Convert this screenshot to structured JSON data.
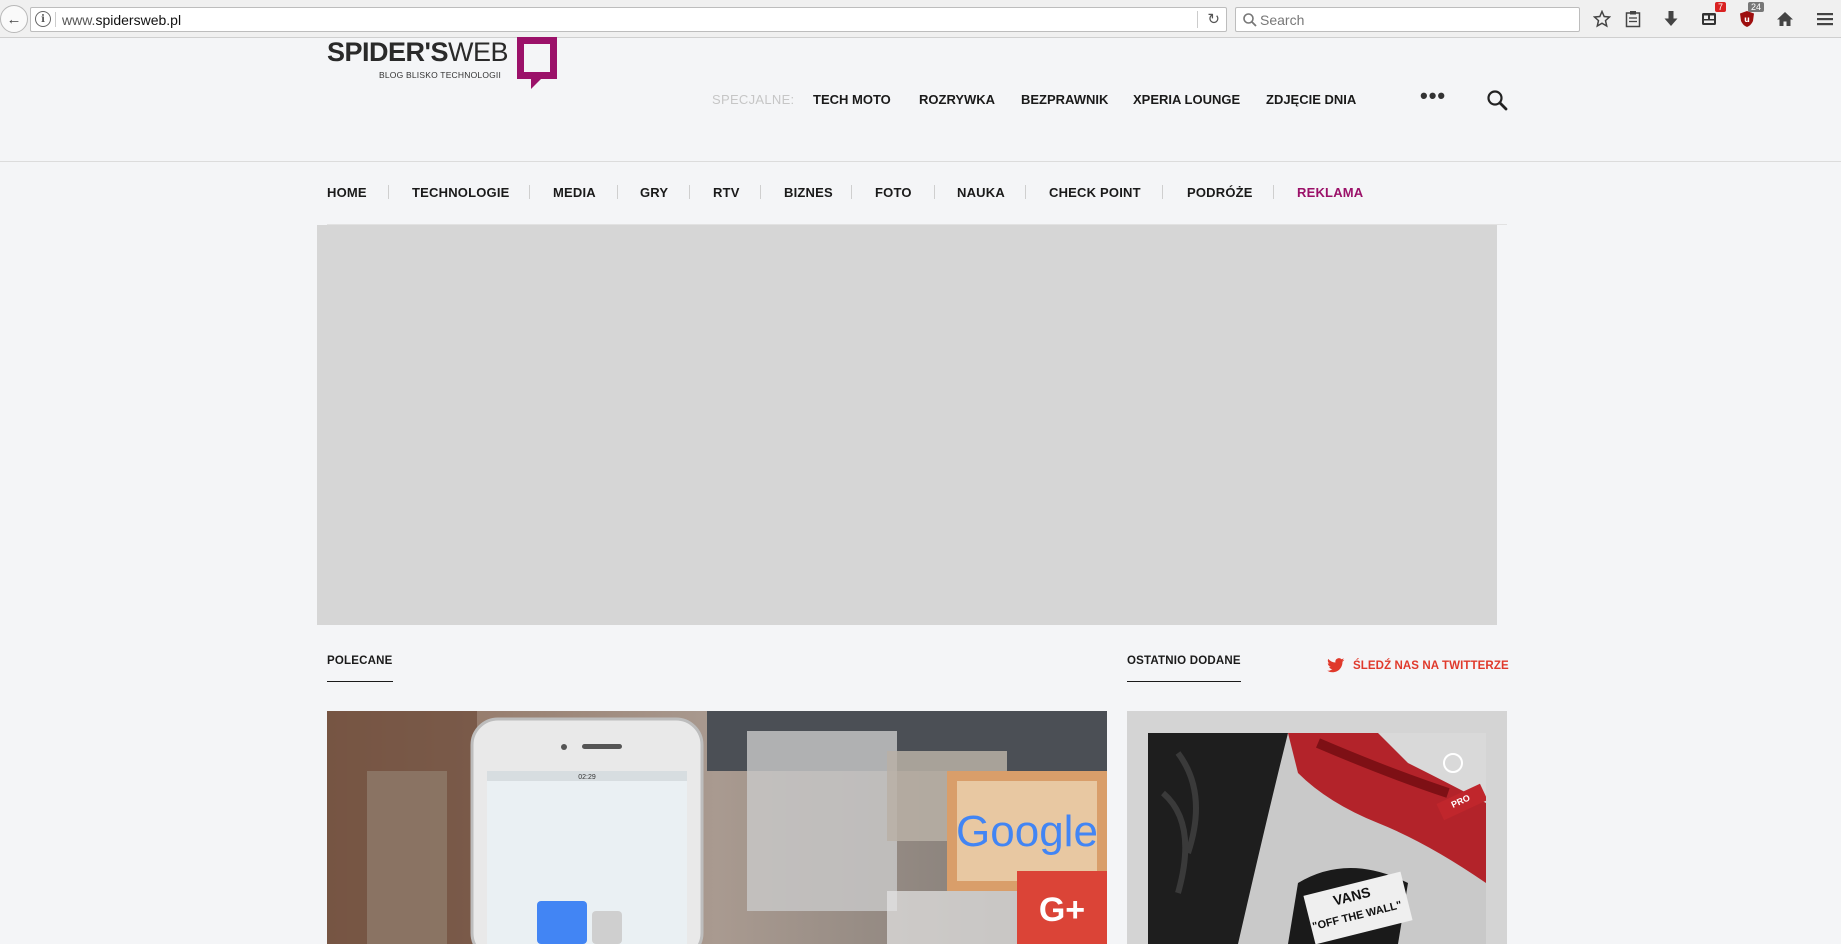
{
  "browser": {
    "url_prefix": "www.",
    "url_host": "spidersweb.pl",
    "search_placeholder": "Search",
    "badges": {
      "messages": "7",
      "extensions": "24"
    }
  },
  "site": {
    "logo_bold": "SPIDER'S",
    "logo_thin": "WEB",
    "logo_tagline": "BLOG BLISKO TECHNOLOGII",
    "special_label": "SPECJALNE:",
    "special_items": [
      "TECH MOTO",
      "ROZRYWKA",
      "BEZPRAWNIK",
      "XPERIA LOUNGE",
      "ZDJĘCIE DNIA"
    ],
    "more_label": "•••"
  },
  "nav": {
    "items": [
      "HOME",
      "TECHNOLOGIE",
      "MEDIA",
      "GRY",
      "RTV",
      "BIZNES",
      "FOTO",
      "NAUKA",
      "CHECK POINT",
      "PODRÓŻE",
      "REKLAMA"
    ]
  },
  "sections": {
    "recommended": "POLECANE",
    "latest": "OSTATNIO DODANE",
    "twitter_follow": "ŚLEDŹ NAS NA TWITTERZE"
  },
  "feature_image": {
    "phone_status": "02:29",
    "sign_text": "Google",
    "gplus": "G+"
  },
  "side_image": {
    "brand": "VANS",
    "slogan": "\"OFF THE WALL\"",
    "tag": "PRO"
  },
  "colors": {
    "brand": "#9b1169",
    "twitter": "#e0392b",
    "ad_bg": "#d6d6d6"
  }
}
